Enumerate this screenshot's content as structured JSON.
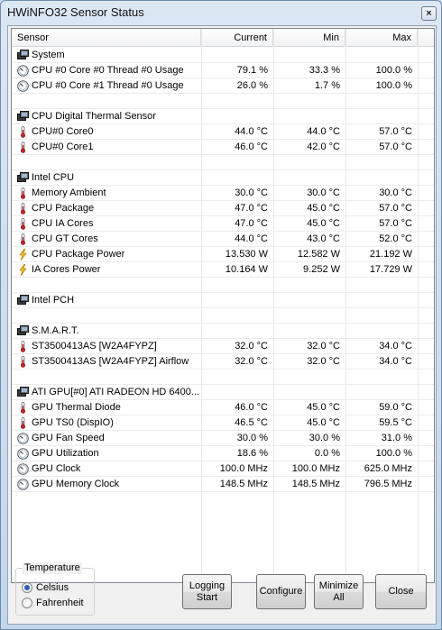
{
  "window": {
    "title": "HWiNFO32 Sensor Status",
    "close_glyph": "×"
  },
  "columns": {
    "sensor": "Sensor",
    "current": "Current",
    "min": "Min",
    "max": "Max"
  },
  "rows": [
    {
      "type": "group",
      "name": "System",
      "icon": "sensor-group-icon"
    },
    {
      "type": "data",
      "name": "CPU #0 Core #0 Thread #0 Usage",
      "current": "79.1 %",
      "min": "33.3 %",
      "max": "100.0 %",
      "icon": "gauge-icon"
    },
    {
      "type": "data",
      "name": "CPU #0 Core #1 Thread #0 Usage",
      "current": "26.0 %",
      "min": "1.7 %",
      "max": "100.0 %",
      "icon": "gauge-icon"
    },
    {
      "type": "blank"
    },
    {
      "type": "group",
      "name": "CPU Digital Thermal Sensor",
      "icon": "sensor-group-icon"
    },
    {
      "type": "data",
      "name": "CPU#0 Core0",
      "current": "44.0 °C",
      "min": "44.0 °C",
      "max": "57.0 °C",
      "icon": "thermometer-icon"
    },
    {
      "type": "data",
      "name": "CPU#0 Core1",
      "current": "46.0 °C",
      "min": "42.0 °C",
      "max": "57.0 °C",
      "icon": "thermometer-icon"
    },
    {
      "type": "blank"
    },
    {
      "type": "group",
      "name": "Intel CPU",
      "icon": "sensor-group-icon"
    },
    {
      "type": "data",
      "name": "Memory Ambient",
      "current": "30.0 °C",
      "min": "30.0 °C",
      "max": "30.0 °C",
      "icon": "thermometer-icon"
    },
    {
      "type": "data",
      "name": "CPU Package",
      "current": "47.0 °C",
      "min": "45.0 °C",
      "max": "57.0 °C",
      "icon": "thermometer-icon"
    },
    {
      "type": "data",
      "name": "CPU IA Cores",
      "current": "47.0 °C",
      "min": "45.0 °C",
      "max": "57.0 °C",
      "icon": "thermometer-icon"
    },
    {
      "type": "data",
      "name": "CPU GT Cores",
      "current": "44.0 °C",
      "min": "43.0 °C",
      "max": "52.0 °C",
      "icon": "thermometer-icon"
    },
    {
      "type": "data",
      "name": "CPU Package Power",
      "current": "13.530 W",
      "min": "12.582 W",
      "max": "21.192 W",
      "icon": "lightning-icon"
    },
    {
      "type": "data",
      "name": "IA Cores Power",
      "current": "10.164 W",
      "min": "9.252 W",
      "max": "17.729 W",
      "icon": "lightning-icon"
    },
    {
      "type": "blank"
    },
    {
      "type": "group",
      "name": "Intel PCH",
      "icon": "sensor-group-icon"
    },
    {
      "type": "blank"
    },
    {
      "type": "group",
      "name": "S.M.A.R.T.",
      "icon": "sensor-group-icon"
    },
    {
      "type": "data",
      "name": "ST3500413AS [W2A4FYPZ]",
      "current": "32.0 °C",
      "min": "32.0 °C",
      "max": "34.0 °C",
      "icon": "thermometer-icon"
    },
    {
      "type": "data",
      "name": "ST3500413AS [W2A4FYPZ] Airflow",
      "current": "32.0 °C",
      "min": "32.0 °C",
      "max": "34.0 °C",
      "icon": "thermometer-icon"
    },
    {
      "type": "blank"
    },
    {
      "type": "group",
      "name": "ATI GPU[#0] ATI RADEON HD 6400...",
      "icon": "sensor-group-icon"
    },
    {
      "type": "data",
      "name": "GPU Thermal Diode",
      "current": "46.0 °C",
      "min": "45.0 °C",
      "max": "59.0 °C",
      "icon": "thermometer-icon"
    },
    {
      "type": "data",
      "name": "GPU TS0 (DispIO)",
      "current": "46.5 °C",
      "min": "45.0 °C",
      "max": "59.5 °C",
      "icon": "thermometer-icon"
    },
    {
      "type": "data",
      "name": "GPU Fan Speed",
      "current": "30.0 %",
      "min": "30.0 %",
      "max": "31.0 %",
      "icon": "gauge-icon"
    },
    {
      "type": "data",
      "name": "GPU Utilization",
      "current": "18.6 %",
      "min": "0.0 %",
      "max": "100.0 %",
      "icon": "gauge-icon"
    },
    {
      "type": "data",
      "name": "GPU Clock",
      "current": "100.0 MHz",
      "min": "100.0 MHz",
      "max": "625.0 MHz",
      "icon": "gauge-icon"
    },
    {
      "type": "data",
      "name": "GPU Memory Clock",
      "current": "148.5 MHz",
      "min": "148.5 MHz",
      "max": "796.5 MHz",
      "icon": "gauge-icon"
    }
  ],
  "temperature": {
    "legend": "Temperature",
    "options": [
      {
        "label": "Celsius",
        "selected": true
      },
      {
        "label": "Fahrenheit",
        "selected": false
      }
    ]
  },
  "buttons": {
    "logging": "Logging\nStart",
    "configure": "Configure",
    "minimize": "Minimize\nAll",
    "close": "Close"
  }
}
